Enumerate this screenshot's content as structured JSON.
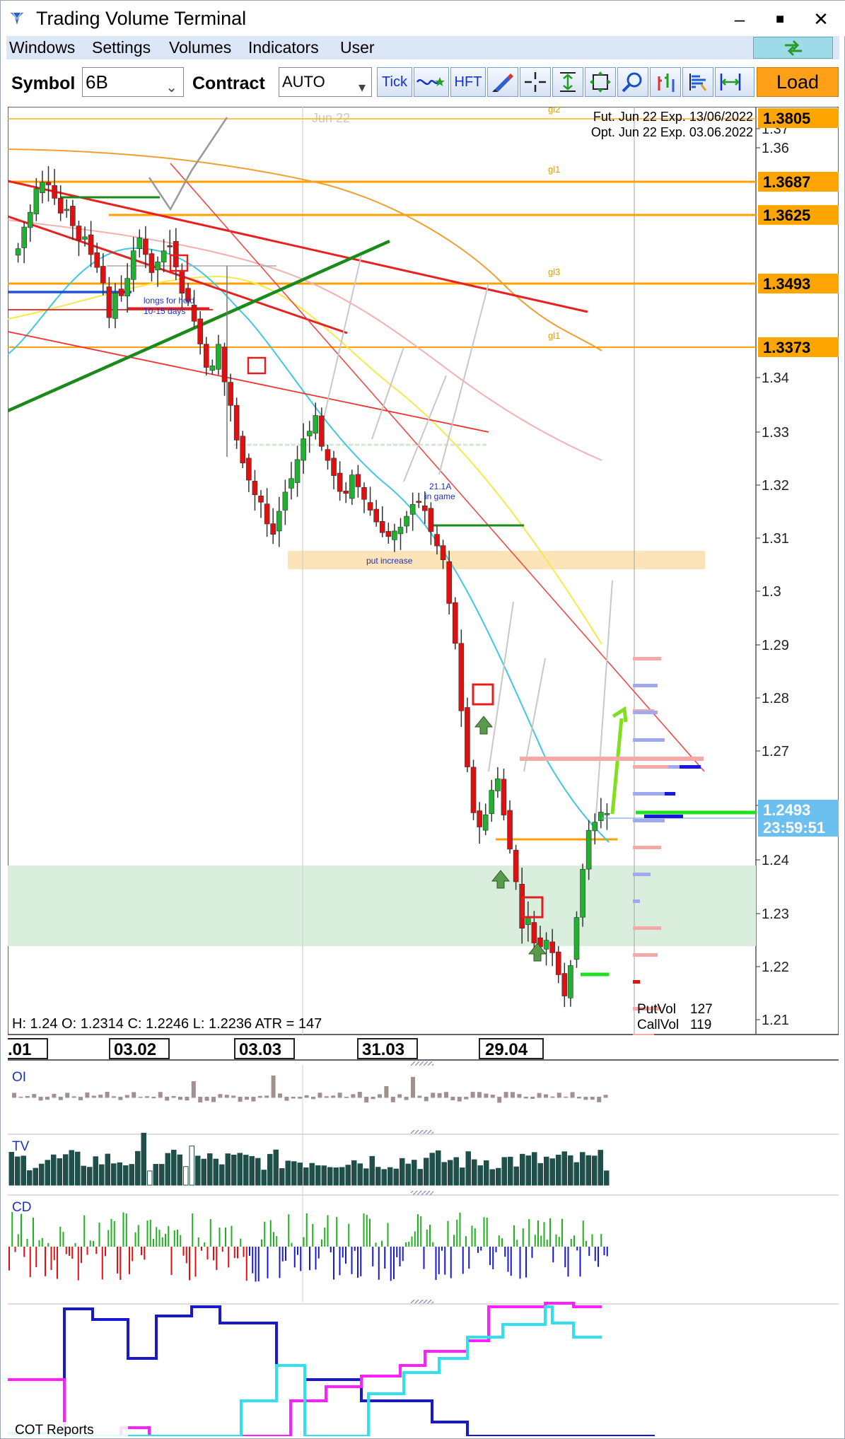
{
  "window": {
    "title": "Trading Volume Terminal",
    "minimize_glyph": "–",
    "maximize_glyph": "■",
    "close_glyph": "✕"
  },
  "menu": [
    "Windows",
    "Settings",
    "Volumes",
    "Indicators",
    "User"
  ],
  "toolbar": {
    "symbol_label": "Symbol",
    "symbol_value": "6B",
    "contract_label": "Contract",
    "contract_value": "AUTO",
    "tick_label": "Tick",
    "hft_label": "HFT",
    "load_label": "Load",
    "icons": [
      "wave-star-icon",
      "pencil-icon",
      "crosshair-icon",
      "vertical-fit-icon",
      "move-icon",
      "zoom-icon",
      "bar-settings-icon",
      "volume-profile-icon",
      "range-icon"
    ]
  },
  "chart": {
    "expiry_fut": "Fut. Jun 22 Exp. 13/06/2022",
    "expiry_opt": "Opt. Jun 22 Exp. 03.06.2022",
    "month_marker": "Jun 22",
    "price_badges": [
      "1.3805",
      "1.3687",
      "1.3625",
      "1.3493",
      "1.3373"
    ],
    "current_price": "1.2493",
    "countdown": "23:59:51",
    "price_ticks": [
      "1.37",
      "1.36",
      "1.34",
      "1.33",
      "1.32",
      "1.31",
      "1.3",
      "1.29",
      "1.28",
      "1.27",
      "1.26",
      "1.24",
      "1.23",
      "1.22",
      "1.21"
    ],
    "level_labels": [
      "gl2",
      "gl1",
      "gl3",
      "gl1"
    ],
    "annotations": {
      "longs": "longs for hold",
      "days": "10-15 days",
      "put_increase": "put increase",
      "note_a": "21.1A",
      "note_b": "in game"
    },
    "ohlc": "H: 1.24   O: 1.2314   C: 1.2246   L: 1.2236   ATR = 147",
    "put_vol_label": "PutVol",
    "put_vol_value": "127",
    "call_vol_label": "CallVol",
    "call_vol_value": "119",
    "date_labels": [
      ".01",
      "03.02",
      "03.03",
      "31.03",
      "29.04"
    ]
  },
  "panels": {
    "oi": "OI",
    "tv": "TV",
    "cd": "CD",
    "cot": "COT Reports"
  },
  "colors": {
    "orange": "#ffa500",
    "bull": "#22b030",
    "bear": "#e01010",
    "trend_red": "#e83030",
    "trend_green": "#1a8a1a",
    "ma_cyan": "#40c8e0",
    "ma_yellow": "#f5e84a",
    "ma_orange": "#f0a030",
    "ma_salmon": "#f0a0a0",
    "current_badge": "#6cc0f0",
    "zone_green": "#d8eedd",
    "zone_orange": "#fde2b8",
    "cot_blue": "#1818d0",
    "cot_magenta": "#ff20ff",
    "cot_cyan": "#30e0f0"
  }
}
